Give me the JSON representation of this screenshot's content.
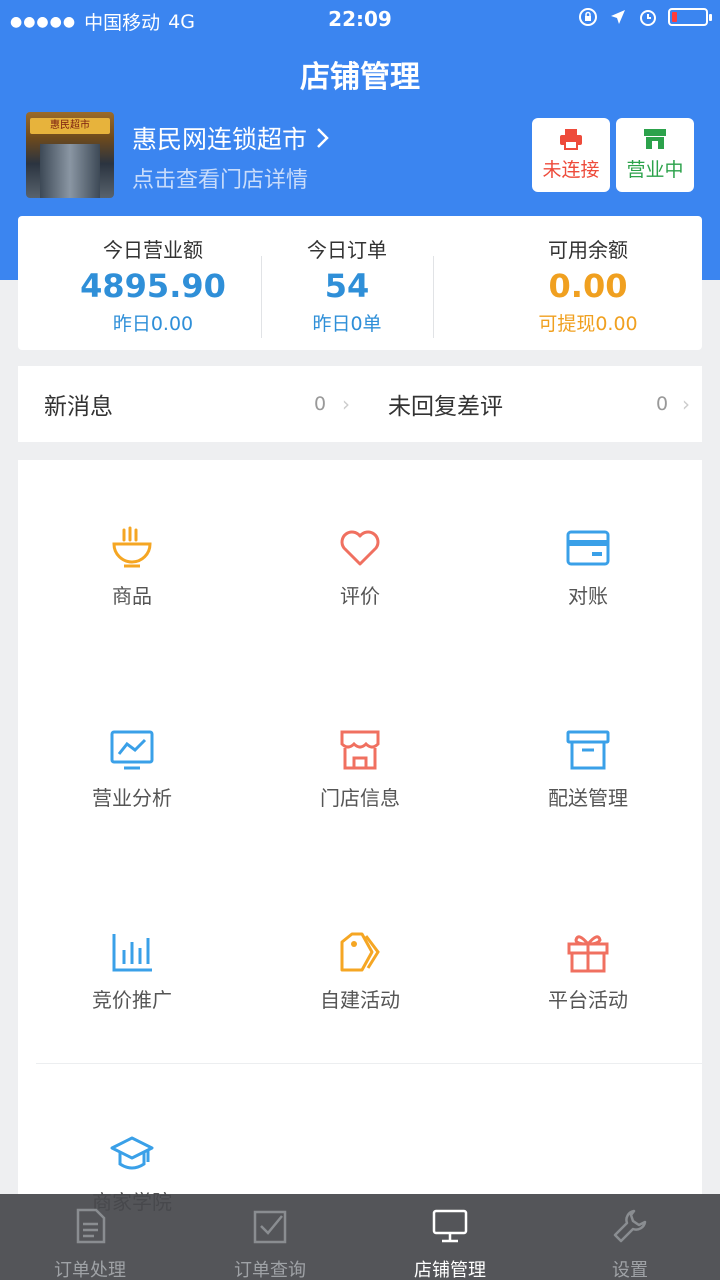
{
  "status_bar": {
    "carrier": "中国移动",
    "network": "4G",
    "time": "22:09",
    "battery_level": 0.15
  },
  "header": {
    "title": "店铺管理",
    "store_name": "惠民网连锁超市",
    "store_subtitle": "点击查看门店详情",
    "store_sign_text": "惠民超市",
    "printer_status": "未连接",
    "business_status": "营业中",
    "colors": {
      "background": "#3b85f0",
      "printer": "#ee4b3b",
      "open": "#2ca24b"
    }
  },
  "stats": {
    "revenue": {
      "label": "今日营业额",
      "value": "4895.90",
      "sub": "昨日0.00"
    },
    "orders": {
      "label": "今日订单",
      "value": "54",
      "sub": "昨日0单"
    },
    "balance": {
      "label": "可用余额",
      "value": "0.00",
      "sub": "可提现0.00"
    }
  },
  "messages": {
    "new_messages": {
      "label": "新消息",
      "count": "0"
    },
    "unreplied_reviews": {
      "label": "未回复差评",
      "count": "0"
    }
  },
  "grid": {
    "items": [
      {
        "label": "商品",
        "icon": "bowl-icon",
        "color": "#f5a623"
      },
      {
        "label": "评价",
        "icon": "heart-icon",
        "color": "#f07060"
      },
      {
        "label": "对账",
        "icon": "card-icon",
        "color": "#3aa0e8"
      },
      {
        "label": "营业分析",
        "icon": "chart-monitor-icon",
        "color": "#3aa0e8"
      },
      {
        "label": "门店信息",
        "icon": "storefront-icon",
        "color": "#f07060"
      },
      {
        "label": "配送管理",
        "icon": "box-icon",
        "color": "#3aa0e8"
      },
      {
        "label": "竞价推广",
        "icon": "bar-chart-icon",
        "color": "#3aa0e8"
      },
      {
        "label": "自建活动",
        "icon": "tag-icon",
        "color": "#f5a623"
      },
      {
        "label": "平台活动",
        "icon": "gift-icon",
        "color": "#f07060"
      },
      {
        "label": "商家学院",
        "icon": "graduation-cap-icon",
        "color": "#3aa0e8"
      }
    ]
  },
  "tabbar": {
    "tabs": [
      {
        "label": "订单处理",
        "icon": "document-icon",
        "active": false
      },
      {
        "label": "订单查询",
        "icon": "checklist-icon",
        "active": false
      },
      {
        "label": "店铺管理",
        "icon": "monitor-icon",
        "active": true
      },
      {
        "label": "设置",
        "icon": "wrench-icon",
        "active": false
      }
    ]
  }
}
